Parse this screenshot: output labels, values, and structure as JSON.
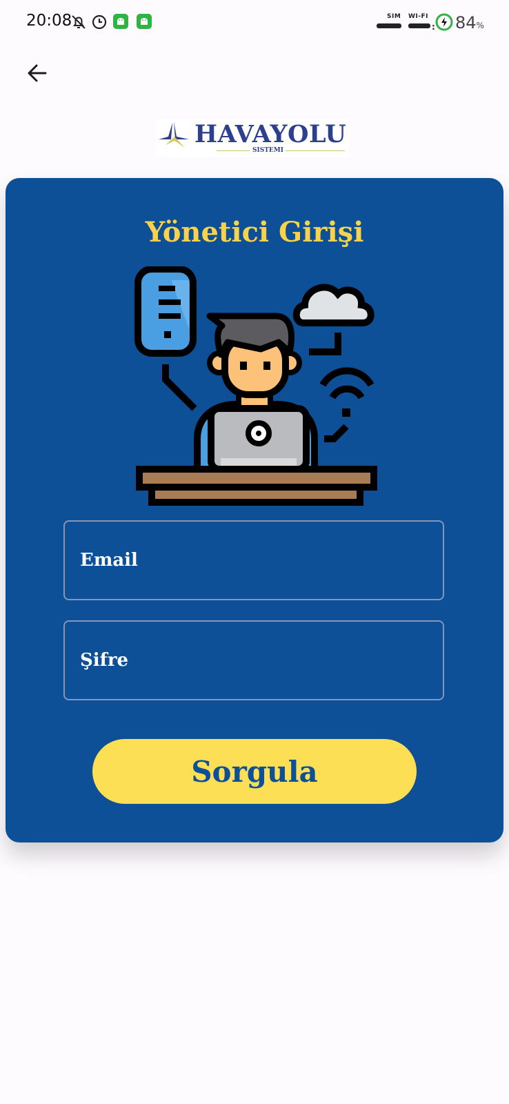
{
  "status_bar": {
    "time": "20:08",
    "sim_label": "SIM",
    "wifi_label": "WI-FI",
    "battery_percent": "84",
    "battery_unit": "%",
    "battery_color": "#2fb344"
  },
  "nav": {
    "back_icon": "arrow-left-icon"
  },
  "logo": {
    "title": "HAVAYOLU",
    "subtitle": "SISTEMI"
  },
  "login_card": {
    "title": "Yönetici Girişi",
    "email_placeholder": "Email",
    "password_placeholder": "Şifre",
    "submit_label": "Sorgula"
  },
  "colors": {
    "card_background": "#0e5097",
    "title_color": "#f8d34a",
    "button_color": "#fddf55"
  }
}
